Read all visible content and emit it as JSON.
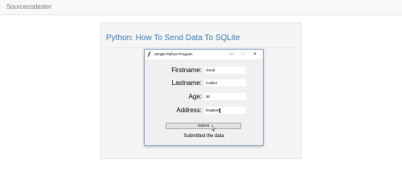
{
  "navbar": {
    "brand": "Sourcecodester"
  },
  "panel": {
    "title": "Python: How To Send Data To SQLite"
  },
  "window": {
    "title": "Simple Python Program",
    "controls": {
      "minimize": "—",
      "maximize": "☐",
      "close": "✕"
    },
    "form": {
      "firstname_label": "Firstname:",
      "firstname_value": "Geral",
      "lastname_label": "Lastname:",
      "lastname_value": "Cokker",
      "age_label": "Age:",
      "age_value": "30",
      "address_label": "Address:",
      "address_value": "England"
    },
    "submit_label": "Submit",
    "status_text": "Submitted the data"
  },
  "colors": {
    "title_link": "#3a7bbf",
    "panel_bg": "#f5f5f5",
    "window_bg": "#f0f0f0"
  }
}
